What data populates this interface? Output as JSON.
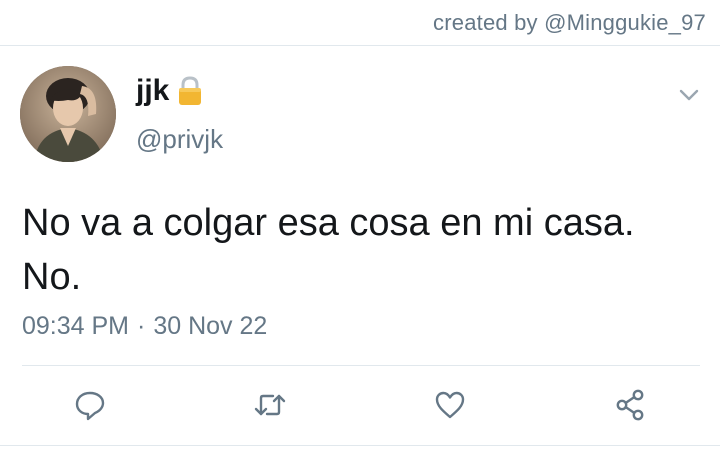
{
  "watermark": {
    "text": "created by @Minggukie_97"
  },
  "tweet": {
    "display_name": "jjk",
    "handle": "@privjk",
    "text": "No va a colgar esa cosa en mi casa.\nNo.",
    "time": "09:34 PM",
    "separator": "·",
    "date": "30 Nov 22"
  },
  "icons": {
    "lock": "lock-icon",
    "more": "chevron-down-icon",
    "reply": "reply-icon",
    "retweet": "retweet-icon",
    "like": "heart-icon",
    "share": "share-icon"
  },
  "colors": {
    "text": "#14171a",
    "secondary": "#657786",
    "icon": "#657786",
    "divider": "#e1e8ed",
    "lock_gold": "#f2b632"
  }
}
